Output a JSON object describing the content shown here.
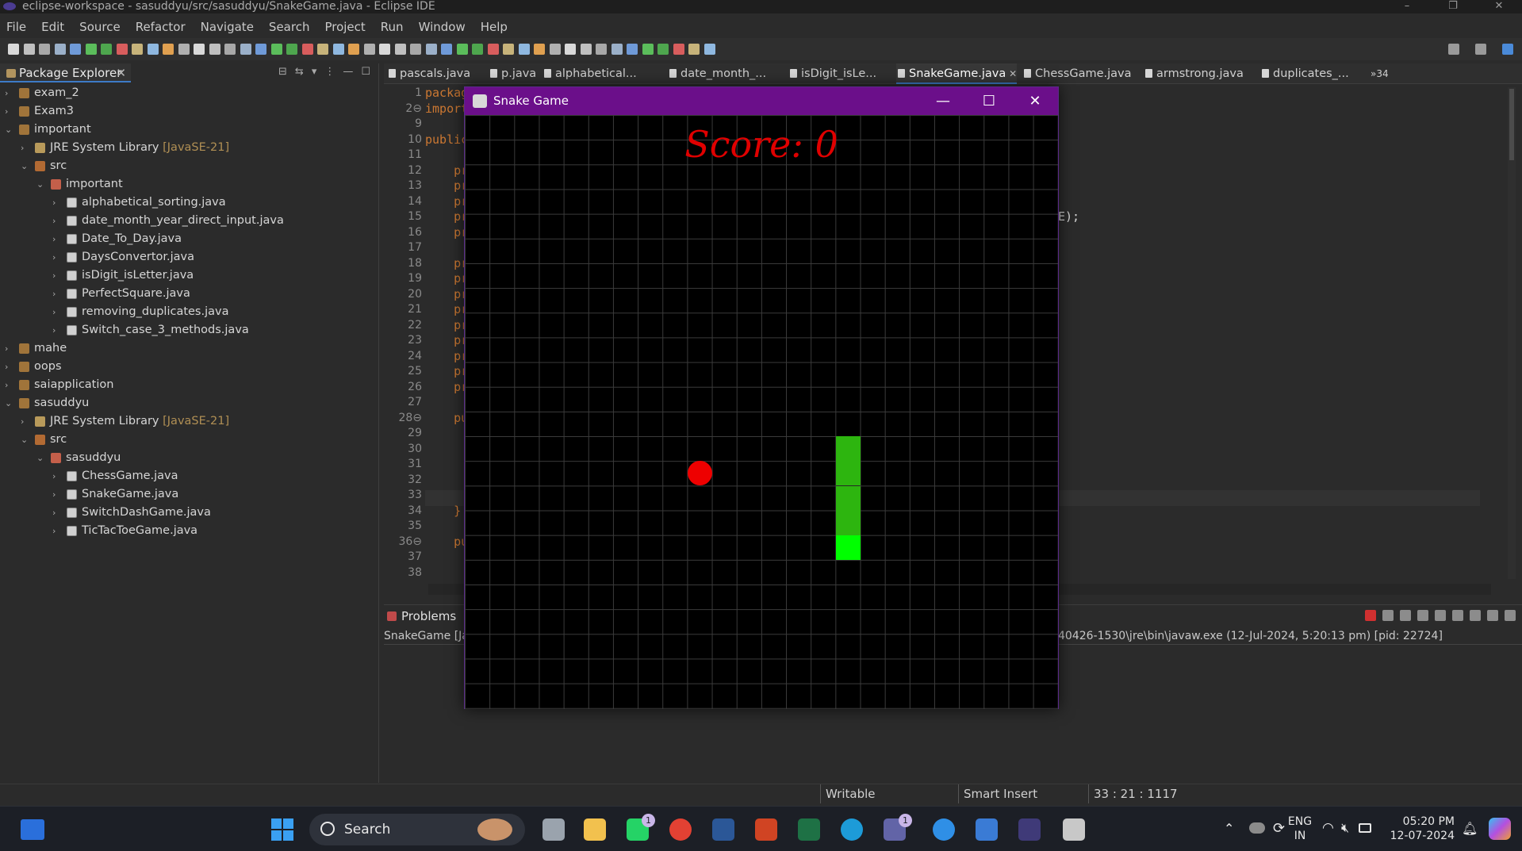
{
  "window": {
    "title": "eclipse-workspace - sasuddyu/src/sasuddyu/SnakeGame.java - Eclipse IDE",
    "controls": [
      "–",
      "❐",
      "✕"
    ]
  },
  "menu": [
    "File",
    "Edit",
    "Source",
    "Refactor",
    "Navigate",
    "Search",
    "Project",
    "Run",
    "Window",
    "Help"
  ],
  "package_explorer": {
    "title": "Package Explorer",
    "close": "✕",
    "tree": [
      {
        "label": "exam_2",
        "suffix": "",
        "indent": 0,
        "arrow": "›",
        "icon": "project-icon"
      },
      {
        "label": "Exam3",
        "suffix": "",
        "indent": 0,
        "arrow": "›",
        "icon": "project-icon"
      },
      {
        "label": "important",
        "suffix": "",
        "indent": 0,
        "arrow": "⌄",
        "icon": "project-icon"
      },
      {
        "label": "JRE System Library ",
        "suffix": "[JavaSE-21]",
        "indent": 1,
        "arrow": "›",
        "icon": "library-icon"
      },
      {
        "label": "src",
        "suffix": "",
        "indent": 1,
        "arrow": "⌄",
        "icon": "source-folder-icon"
      },
      {
        "label": "important",
        "suffix": "",
        "indent": 2,
        "arrow": "⌄",
        "icon": "package-icon"
      },
      {
        "label": "alphabetical_sorting.java",
        "suffix": "",
        "indent": 3,
        "arrow": "›",
        "icon": "java-file-icon"
      },
      {
        "label": "date_month_year_direct_input.java",
        "suffix": "",
        "indent": 3,
        "arrow": "›",
        "icon": "java-file-icon"
      },
      {
        "label": "Date_To_Day.java",
        "suffix": "",
        "indent": 3,
        "arrow": "›",
        "icon": "java-file-icon"
      },
      {
        "label": "DaysConvertor.java",
        "suffix": "",
        "indent": 3,
        "arrow": "›",
        "icon": "java-file-icon"
      },
      {
        "label": "isDigit_isLetter.java",
        "suffix": "",
        "indent": 3,
        "arrow": "›",
        "icon": "java-file-icon"
      },
      {
        "label": "PerfectSquare.java",
        "suffix": "",
        "indent": 3,
        "arrow": "›",
        "icon": "java-file-icon"
      },
      {
        "label": "removing_duplicates.java",
        "suffix": "",
        "indent": 3,
        "arrow": "›",
        "icon": "java-file-icon"
      },
      {
        "label": "Switch_case_3_methods.java",
        "suffix": "",
        "indent": 3,
        "arrow": "›",
        "icon": "java-file-icon"
      },
      {
        "label": "mahe",
        "suffix": "",
        "indent": 0,
        "arrow": "›",
        "icon": "project-icon"
      },
      {
        "label": "oops",
        "suffix": "",
        "indent": 0,
        "arrow": "›",
        "icon": "project-icon"
      },
      {
        "label": "saiapplication",
        "suffix": "",
        "indent": 0,
        "arrow": "›",
        "icon": "project-icon"
      },
      {
        "label": "sasuddyu",
        "suffix": "",
        "indent": 0,
        "arrow": "⌄",
        "icon": "project-icon"
      },
      {
        "label": "JRE System Library ",
        "suffix": "[JavaSE-21]",
        "indent": 1,
        "arrow": "›",
        "icon": "library-icon"
      },
      {
        "label": "src",
        "suffix": "",
        "indent": 1,
        "arrow": "⌄",
        "icon": "source-folder-icon"
      },
      {
        "label": "sasuddyu",
        "suffix": "",
        "indent": 2,
        "arrow": "⌄",
        "icon": "package-icon"
      },
      {
        "label": "ChessGame.java",
        "suffix": "",
        "indent": 3,
        "arrow": "›",
        "icon": "java-file-icon"
      },
      {
        "label": "SnakeGame.java",
        "suffix": "",
        "indent": 3,
        "arrow": "›",
        "icon": "java-file-icon"
      },
      {
        "label": "SwitchDashGame.java",
        "suffix": "",
        "indent": 3,
        "arrow": "›",
        "icon": "java-file-icon"
      },
      {
        "label": "TicTacToeGame.java",
        "suffix": "",
        "indent": 3,
        "arrow": "›",
        "icon": "java-file-icon"
      }
    ]
  },
  "editor": {
    "tabs": [
      {
        "label": "pascals.java",
        "active": false
      },
      {
        "label": "p.java",
        "active": false
      },
      {
        "label": "alphabetical...",
        "active": false
      },
      {
        "label": "date_month_...",
        "active": false
      },
      {
        "label": "isDigit_isLe...",
        "active": false
      },
      {
        "label": "SnakeGame.java",
        "active": true
      },
      {
        "label": "ChessGame.java",
        "active": false
      },
      {
        "label": "armstrong.java",
        "active": false
      },
      {
        "label": "duplicates_...",
        "active": false
      }
    ],
    "overflow": "»34",
    "line_numbers": [
      "1",
      "2⊖",
      "9",
      "10",
      "11",
      "12",
      "13",
      "14",
      "15",
      "16",
      "17",
      "18",
      "19",
      "20",
      "21",
      "22",
      "23",
      "24",
      "25",
      "26",
      "27",
      "28⊖",
      "29",
      "30",
      "31",
      "32",
      "33",
      "34",
      "35",
      "36⊖",
      "37",
      "38"
    ],
    "code_lines": [
      "packag",
      "import",
      "",
      "public",
      "",
      "    pr",
      "    pr",
      "    pr",
      "    pr",
      "    pr",
      "",
      "    pr",
      "    pr",
      "    pr",
      "    pr",
      "    pr",
      "    pr",
      "    pr",
      "    pr",
      "    pr",
      "",
      "    pu",
      "",
      "",
      "",
      "",
      "",
      "    }",
      "",
      "    pu",
      "",
      ""
    ],
    "code_fragment_right": "E);"
  },
  "console": {
    "tab_label": "Problems",
    "launch_left": "SnakeGame [Ja",
    "launch_right": "40426-1530\\jre\\bin\\javaw.exe  (12-Jul-2024, 5:20:13 pm) [pid: 22724]"
  },
  "statusbar": {
    "writable": "Writable",
    "insert_mode": "Smart Insert",
    "position": "33 : 21 : 1117"
  },
  "snake_game": {
    "title": "Snake Game",
    "controls": [
      "—",
      "☐",
      "✕"
    ],
    "score_text": "Score: 0",
    "grid_columns": 24,
    "grid_rows": 24,
    "food": {
      "col": 9,
      "row": 14,
      "color": "#ee0000"
    },
    "snake": [
      {
        "col": 15,
        "row": 13,
        "color": "#2db50f"
      },
      {
        "col": 15,
        "row": 14,
        "color": "#2db50f"
      },
      {
        "col": 15,
        "row": 15,
        "color": "#2db50f"
      },
      {
        "col": 15,
        "row": 16,
        "color": "#2db50f"
      },
      {
        "col": 15,
        "row": 17,
        "color": "#00ff00"
      }
    ],
    "background_color": "#000000",
    "grid_color": "#3b3b3b"
  },
  "taskbar": {
    "search_label": "Search",
    "apps": [
      {
        "name": "task-view-icon",
        "color": "#9aa3ad"
      },
      {
        "name": "file-explorer-icon",
        "color": "#f2c14e"
      },
      {
        "name": "whatsapp-icon",
        "color": "#25d366",
        "badge": "1"
      },
      {
        "name": "chrome-icon",
        "color": "#e34133"
      },
      {
        "name": "word-icon",
        "color": "#2b5797"
      },
      {
        "name": "powerpoint-icon",
        "color": "#d04423"
      },
      {
        "name": "excel-icon",
        "color": "#1e7145"
      },
      {
        "name": "edge-icon",
        "color": "#1d9bd8"
      },
      {
        "name": "teams-icon",
        "color": "#6264a7",
        "badge": "1"
      },
      {
        "name": "help-icon",
        "color": "#2f8fe6"
      },
      {
        "name": "store-icon",
        "color": "#3a7bd5"
      },
      {
        "name": "eclipse-icon",
        "color": "#3f3a78"
      },
      {
        "name": "java-app-icon",
        "color": "#c8c8c8"
      }
    ],
    "language": [
      "ENG",
      "IN"
    ],
    "time": "05:20 PM",
    "date": "12-07-2024"
  }
}
